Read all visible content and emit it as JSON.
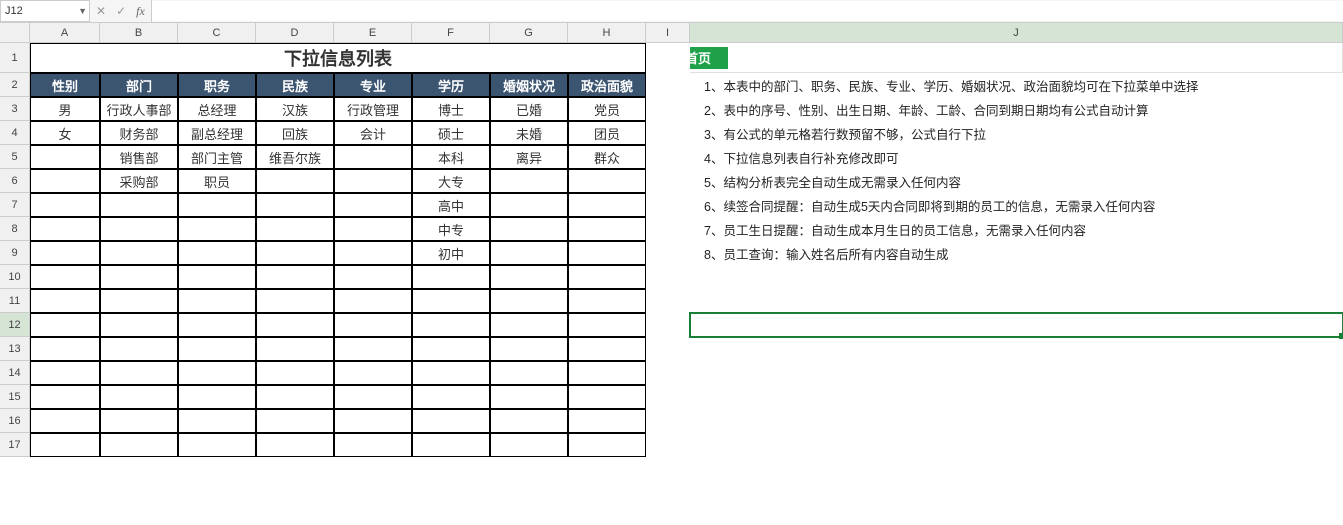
{
  "formula_bar": {
    "cell_ref": "J12",
    "formula_value": ""
  },
  "columns": [
    "A",
    "B",
    "C",
    "D",
    "E",
    "F",
    "G",
    "H",
    "I",
    "J"
  ],
  "col_widths": {
    "A": 70,
    "B": 78,
    "C": 78,
    "D": 78,
    "E": 78,
    "F": 78,
    "G": 78,
    "H": 78,
    "I": 44,
    "J": 653
  },
  "row_count": 17,
  "row_heights": {
    "1": 30,
    "2": 24,
    "3": 24,
    "4": 24,
    "5": 24,
    "6": 24,
    "7": 24,
    "8": 24,
    "9": 24,
    "10": 24,
    "11": 24,
    "12": 24,
    "13": 24,
    "14": 24,
    "15": 24,
    "16": 24,
    "17": 24
  },
  "title": "下拉信息列表",
  "table_headers": [
    "性别",
    "部门",
    "职务",
    "民族",
    "专业",
    "学历",
    "婚姻状况",
    "政治面貌"
  ],
  "table_rows": [
    [
      "男",
      "行政人事部",
      "总经理",
      "汉族",
      "行政管理",
      "博士",
      "已婚",
      "党员"
    ],
    [
      "女",
      "财务部",
      "副总经理",
      "回族",
      "会计",
      "硕士",
      "未婚",
      "团员"
    ],
    [
      "",
      "销售部",
      "部门主管",
      "维吾尔族",
      "",
      "本科",
      "离异",
      "群众"
    ],
    [
      "",
      "采购部",
      "职员",
      "",
      "",
      "大专",
      "",
      ""
    ],
    [
      "",
      "",
      "",
      "",
      "",
      "高中",
      "",
      ""
    ],
    [
      "",
      "",
      "",
      "",
      "",
      "中专",
      "",
      ""
    ],
    [
      "",
      "",
      "",
      "",
      "",
      "初中",
      "",
      ""
    ]
  ],
  "home_button_label": "首页",
  "notes": [
    "1、本表中的部门、职务、民族、专业、学历、婚姻状况、政治面貌均可在下拉菜单中选择",
    "2、表中的序号、性别、出生日期、年龄、工龄、合同到期日期均有公式自动计算",
    "3、有公式的单元格若行数预留不够，公式自行下拉",
    "4、下拉信息列表自行补充修改即可",
    "5、结构分析表完全自动生成无需录入任何内容",
    "6、续签合同提醒：自动生成5天内合同即将到期的员工的信息，无需录入任何内容",
    "7、员工生日提醒：自动生成本月生日的员工信息，无需录入任何内容",
    "8、员工查询：输入姓名后所有内容自动生成"
  ],
  "active_cell": "J12",
  "selected_col": "J",
  "selected_row": 12
}
